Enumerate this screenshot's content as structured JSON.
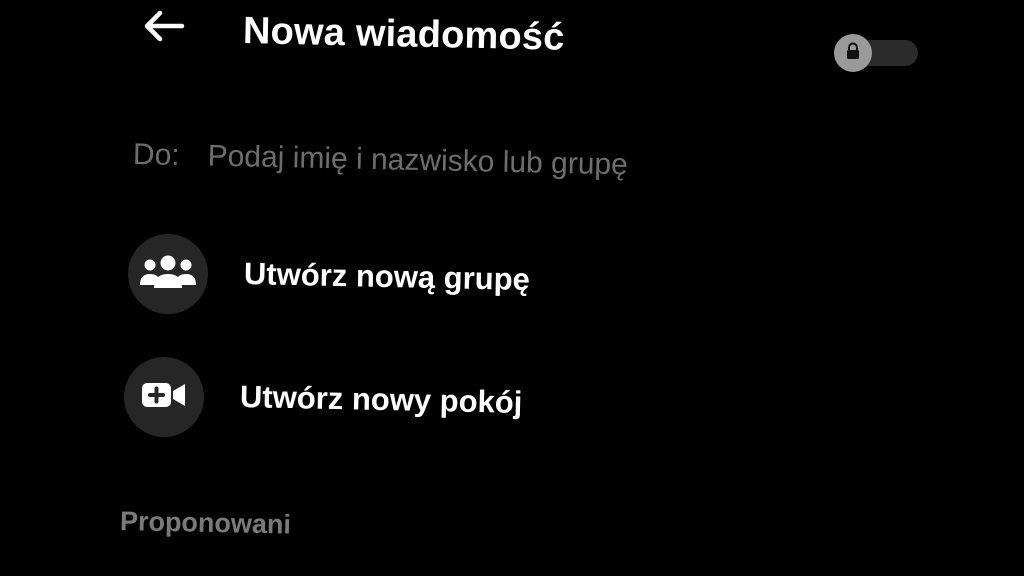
{
  "header": {
    "back_icon": "arrow-left-icon",
    "title": "Nowa wiadomość",
    "lock_toggle": {
      "icon": "lock-icon",
      "state": "off"
    }
  },
  "recipient": {
    "label": "Do:",
    "placeholder": "Podaj imię i nazwisko lub grupę",
    "value": ""
  },
  "actions": [
    {
      "icon": "people-group-icon",
      "label": "Utwórz nową grupę"
    },
    {
      "icon": "video-add-icon",
      "label": "Utwórz nowy pokój"
    }
  ],
  "suggested_section": {
    "title": "Proponowani"
  },
  "colors": {
    "background": "#000000",
    "text_primary": "#ffffff",
    "text_muted": "#6d6d6d",
    "icon_circle": "#262626",
    "toggle_knob": "#9a9a9a",
    "toggle_track": "#2b2b2b"
  }
}
